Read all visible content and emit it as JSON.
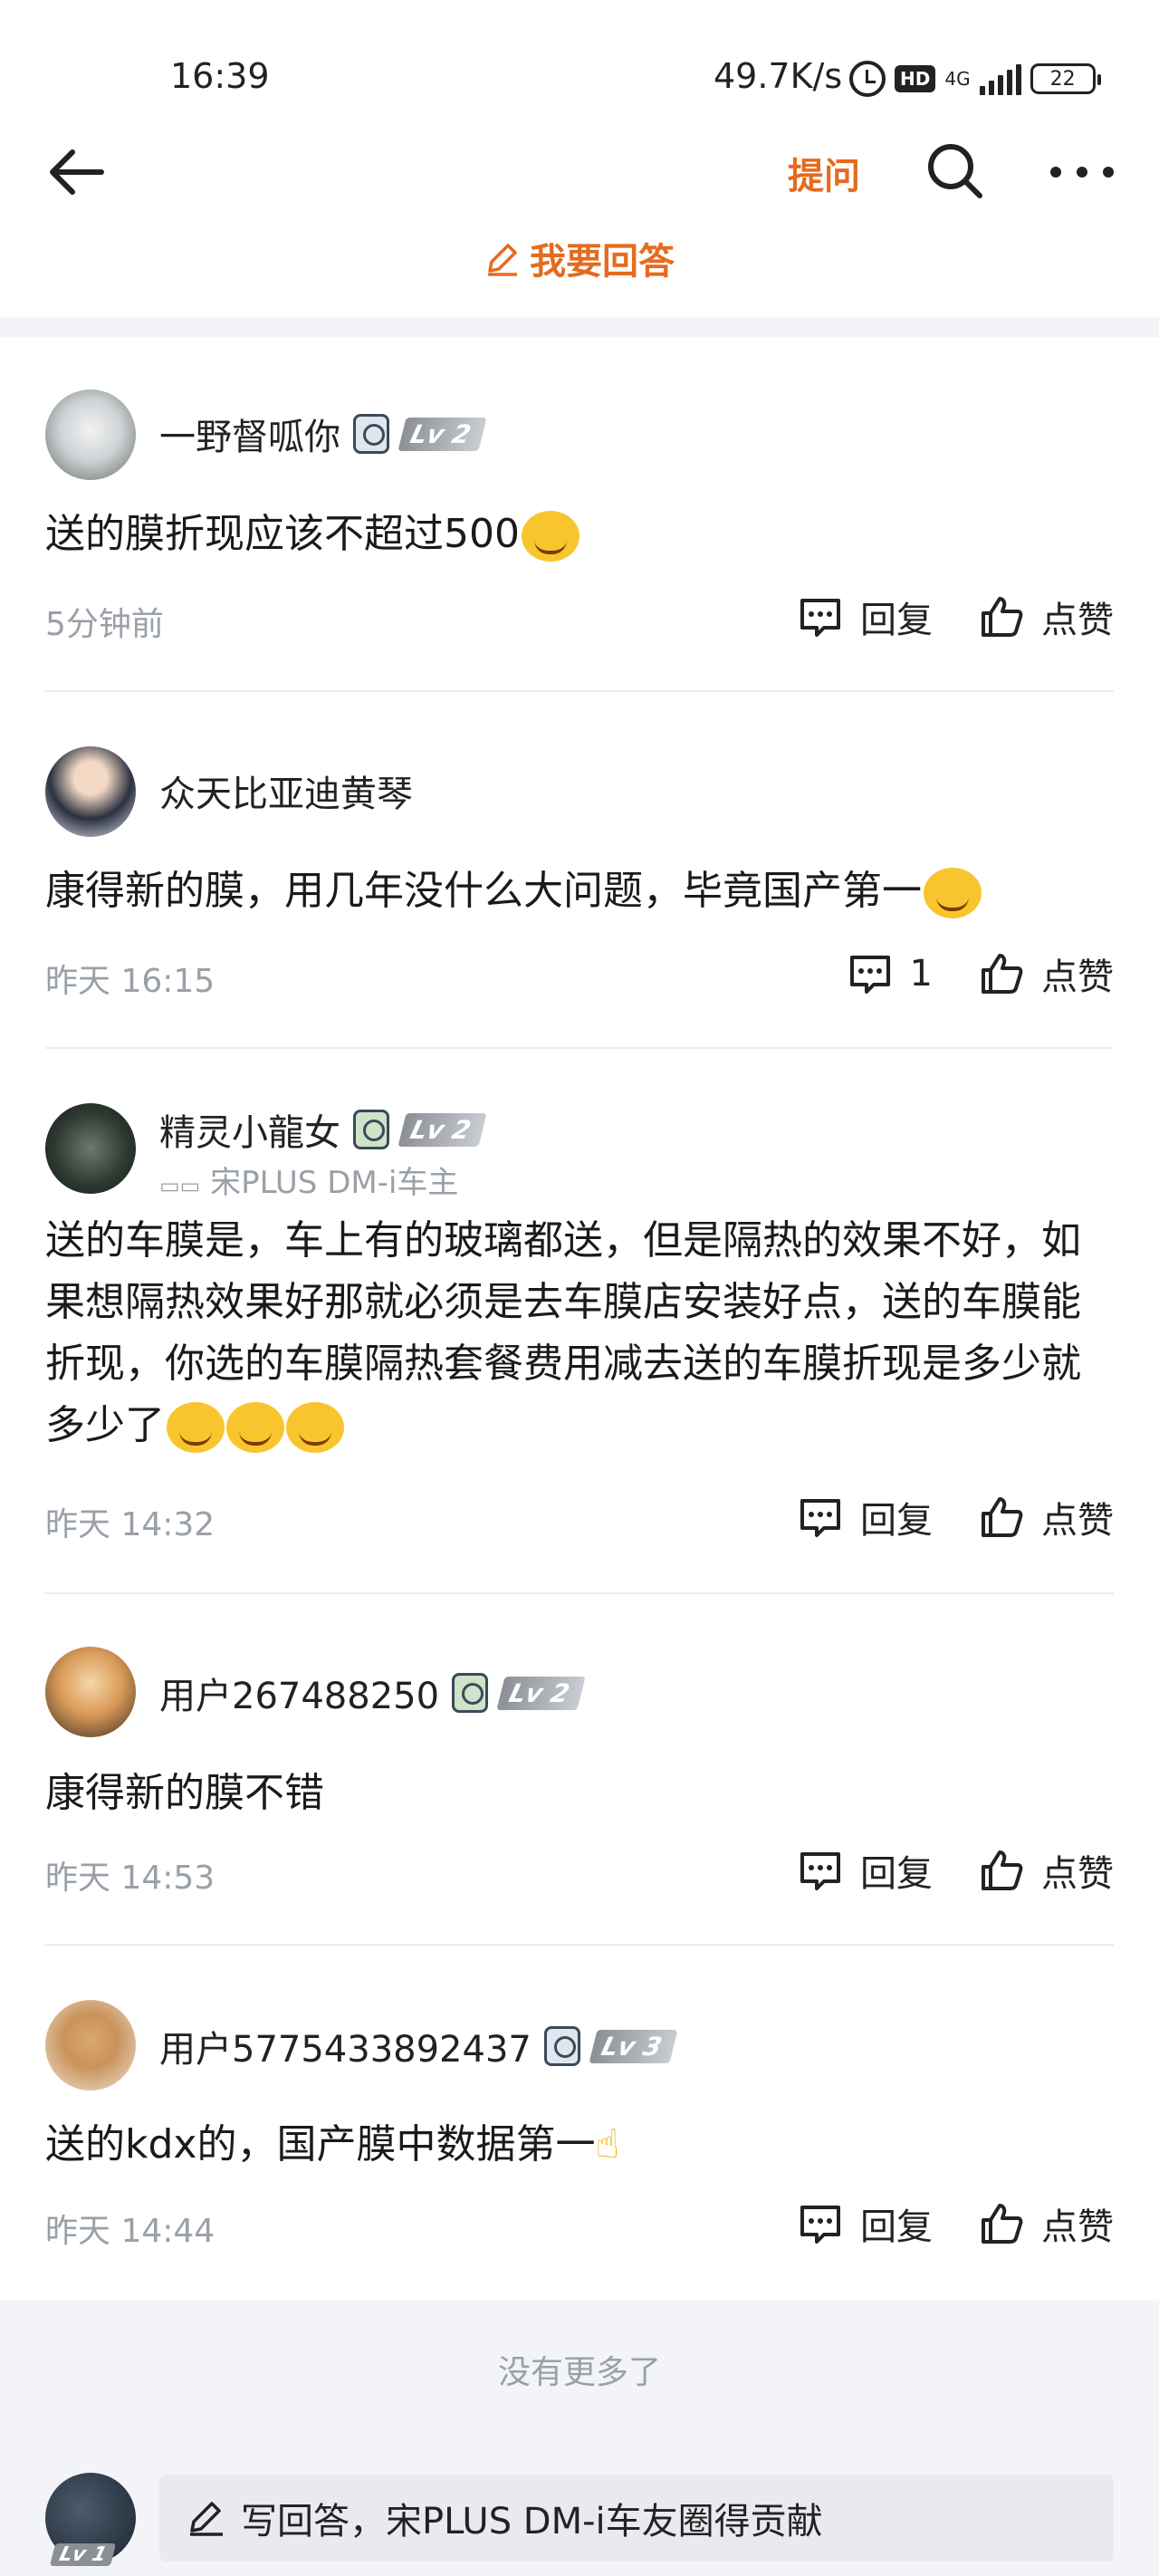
{
  "status_bar": {
    "time": "16:39",
    "speed": "49.7K/s",
    "hd": "HD",
    "network": "4G",
    "battery": "22"
  },
  "header": {
    "ask_label": "提问",
    "answer_label": "我要回答"
  },
  "comments": [
    {
      "name": "一野督呱你",
      "level": "Lv 2",
      "car_owner": "",
      "text": "送的膜折现应该不超过500",
      "time": "5分钟前",
      "reply_label": "回复",
      "like_label": "点赞"
    },
    {
      "name": "众天比亚迪黄琴",
      "level": "",
      "car_owner": "",
      "text": "康得新的膜，用几年没什么大问题，毕竟国产第一",
      "time": "昨天 16:15",
      "reply_label": "1",
      "like_label": "点赞"
    },
    {
      "name": "精灵小龍女",
      "level": "Lv 2",
      "car_owner": "宋PLUS DM-i车主",
      "text": "送的车膜是，车上有的玻璃都送，但是隔热的效果不好，如果想隔热效果好那就必须是去车膜店安装好点，送的车膜能折现，你选的车膜隔热套餐费用减去送的车膜折现是多少就多少了",
      "time": "昨天 14:32",
      "reply_label": "回复",
      "like_label": "点赞"
    },
    {
      "name": "用户267488250",
      "level": "Lv 2",
      "car_owner": "",
      "text": "康得新的膜不错",
      "time": "昨天 14:53",
      "reply_label": "回复",
      "like_label": "点赞"
    },
    {
      "name": "用户5775433892437",
      "level": "Lv 3",
      "car_owner": "",
      "text": "送的kdx的，国产膜中数据第一",
      "time": "昨天 14:44",
      "reply_label": "回复",
      "like_label": "点赞"
    }
  ],
  "footer": {
    "no_more": "没有更多了",
    "my_level": "Lv 1",
    "write_placeholder": "写回答，宋PLUS DM-i车友圈得贡献"
  },
  "colors": {
    "accent": "#e56b1f",
    "muted": "#9aa0a8",
    "band": "#f3f4f8"
  }
}
